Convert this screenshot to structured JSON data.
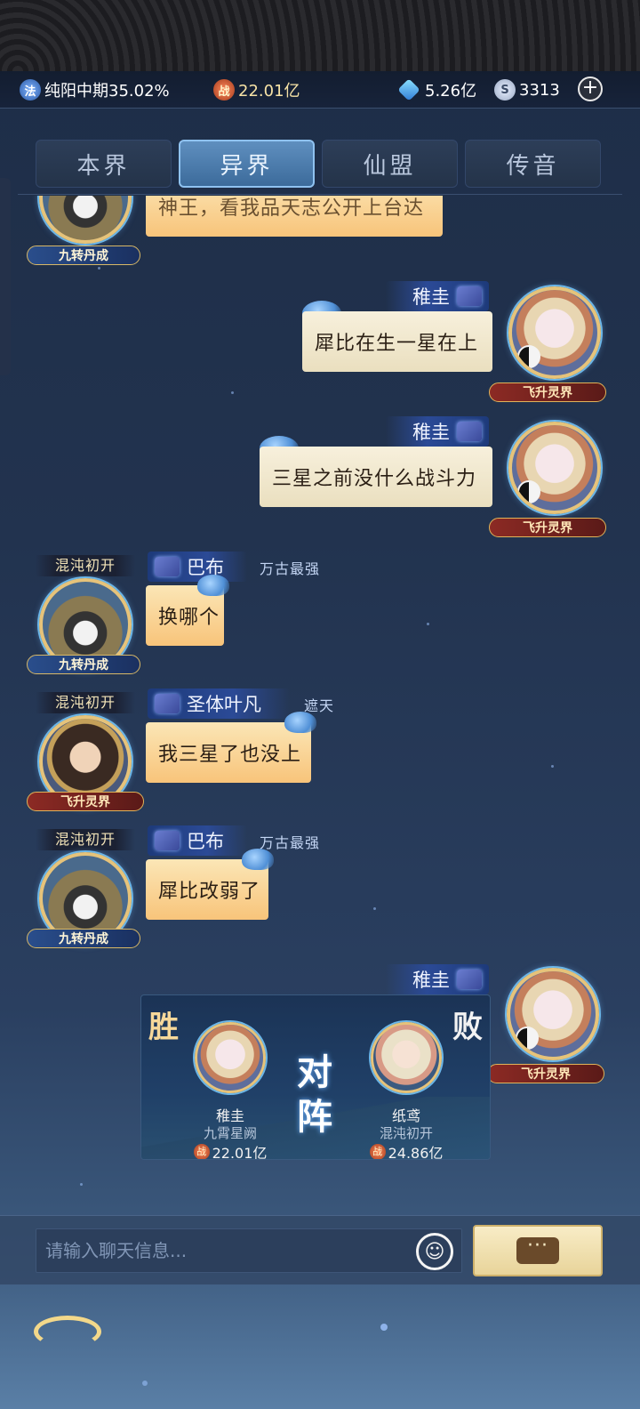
{
  "resources": {
    "cultivation_icon": "法",
    "cultivation": "纯阳中期35.02%",
    "power_icon": "战",
    "power": "22.01亿",
    "gems": "5.26亿",
    "coins": "3313",
    "plus_icon": "plus-icon"
  },
  "tabs": [
    {
      "label": "本界",
      "active": false
    },
    {
      "label": "异界",
      "active": true
    },
    {
      "label": "仙盟",
      "active": false
    },
    {
      "label": "传音",
      "active": false
    }
  ],
  "messages": [
    {
      "side": "left",
      "partial": true,
      "badge": "九转丹成",
      "text": "神王，看我品天志公开上台达"
    },
    {
      "side": "right",
      "name": "稚圭",
      "badge": "飞升灵界",
      "text": "犀比在生一星在上"
    },
    {
      "side": "right",
      "name": "稚圭",
      "badge": "飞升灵界",
      "text": "三星之前没什么战斗力"
    },
    {
      "side": "left",
      "realm": "混沌初开",
      "name": "巴布",
      "title": "万古最强",
      "badge": "九转丹成",
      "text": "换哪个"
    },
    {
      "side": "left",
      "realm": "混沌初开",
      "name": "圣体叶凡",
      "title": "遮天",
      "badge": "飞升灵界",
      "text": "我三星了也没上"
    },
    {
      "side": "left",
      "realm": "混沌初开",
      "name": "巴布",
      "title": "万古最强",
      "badge": "九转丹成",
      "text": "犀比改弱了"
    },
    {
      "side": "right",
      "name": "稚圭",
      "badge": "飞升灵界"
    }
  ],
  "battle": {
    "win_label": "胜",
    "lose_label": "败",
    "vs_label_1": "对",
    "vs_label_2": "阵",
    "left": {
      "name": "稚圭",
      "realm": "九霄星阙",
      "power": "22.01亿"
    },
    "right": {
      "name": "纸鸢",
      "realm": "混沌初开",
      "power": "24.86亿"
    }
  },
  "input": {
    "placeholder": "请输入聊天信息...",
    "value": "",
    "send_icon": "···"
  },
  "colors": {
    "accent_gold": "#e6c37a",
    "tab_active": "#5f8fbf",
    "bubble_orange": "#f8c47a",
    "bubble_cream": "#eadfbf"
  }
}
